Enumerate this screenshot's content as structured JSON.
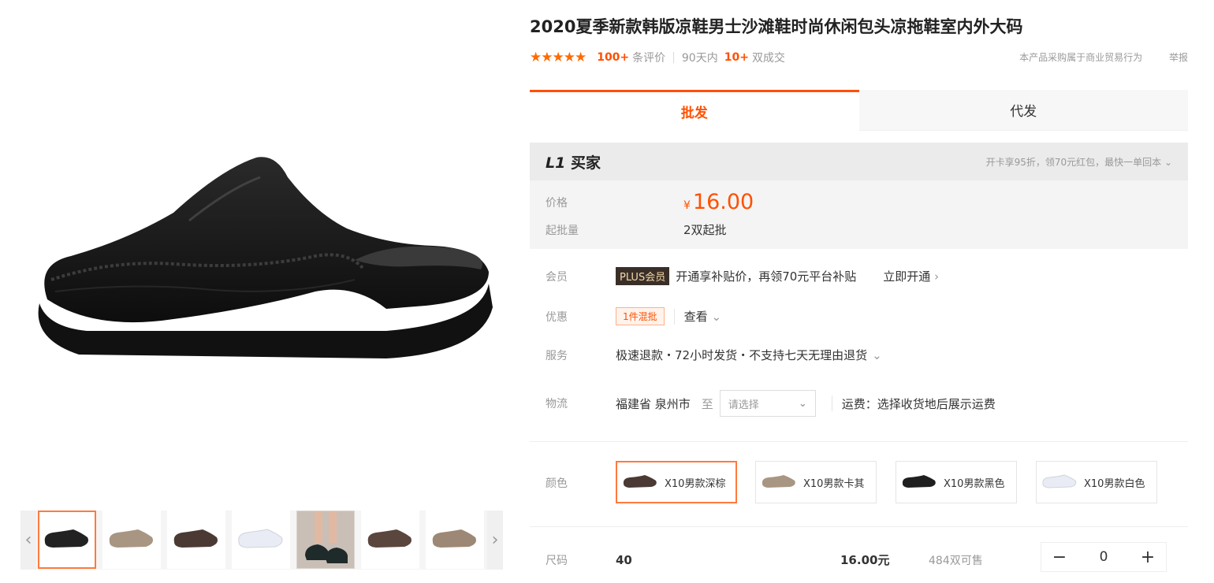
{
  "product": {
    "title": "2020夏季新款韩版凉鞋男士沙滩鞋时尚休闲包头凉拖鞋室内外大码",
    "stars_glyph": "★★★★★",
    "review_count": "100+",
    "review_label": "条评价",
    "period_label": "90天内",
    "deal_count": "10+",
    "deal_label": "双成交",
    "purchase_note": "本产品采购属于商业贸易行为",
    "report_label": "举报"
  },
  "tabs": [
    {
      "label": "批发",
      "active": true
    },
    {
      "label": "代发",
      "active": false
    }
  ],
  "price_box": {
    "buyer_level": "L1",
    "buyer_label": "买家",
    "benefits": "开卡享95折，领70元红包，最快一单回本",
    "price_label": "价格",
    "currency": "¥",
    "price": "16.00",
    "moq_label": "起批量",
    "moq": "2双起批"
  },
  "member": {
    "label": "会员",
    "badge": "PLUS会员",
    "text": "开通享补贴价，再领70元平台补贴",
    "link": "立即开通"
  },
  "promo": {
    "label": "优惠",
    "badge": "1件混批",
    "view": "查看"
  },
  "service": {
    "label": "服务",
    "text": "极速退款・72小时发货・不支持七天无理由退货"
  },
  "logistics": {
    "label": "物流",
    "origin": "福建省 泉州市",
    "to": "至",
    "select_placeholder": "请选择",
    "shipping": "运费：选择收货地后展示运费"
  },
  "colors": {
    "label": "颜色",
    "options": [
      {
        "label": "X10男款深棕",
        "swatch": "#4a3a33",
        "active": true
      },
      {
        "label": "X10男款卡其",
        "swatch": "#a89682",
        "active": false
      },
      {
        "label": "X10男款黑色",
        "swatch": "#1f1f1f",
        "active": false
      },
      {
        "label": "X10男款白色",
        "swatch": "#e9ecf4",
        "active": false
      }
    ]
  },
  "sizes": {
    "label": "尺码",
    "rows": [
      {
        "size": "40",
        "price": "16.00元",
        "stock": "484双可售",
        "qty": "0"
      }
    ]
  },
  "gallery": {
    "thumbnails": [
      {
        "name": "thumb-black",
        "color": "#222222"
      },
      {
        "name": "thumb-khaki",
        "color": "#a89682"
      },
      {
        "name": "thumb-brown",
        "color": "#4a3a33"
      },
      {
        "name": "thumb-white",
        "color": "#e9ecf4"
      },
      {
        "name": "thumb-photo",
        "color": "#1f2a2a"
      },
      {
        "name": "thumb-brown-2",
        "color": "#5a463d"
      },
      {
        "name": "thumb-khaki-2",
        "color": "#9c8874"
      }
    ]
  },
  "icons": {
    "prev": "chevron-left",
    "next": "chevron-right",
    "dropdown": "chevron-down"
  },
  "accent_color": "#ff5000"
}
